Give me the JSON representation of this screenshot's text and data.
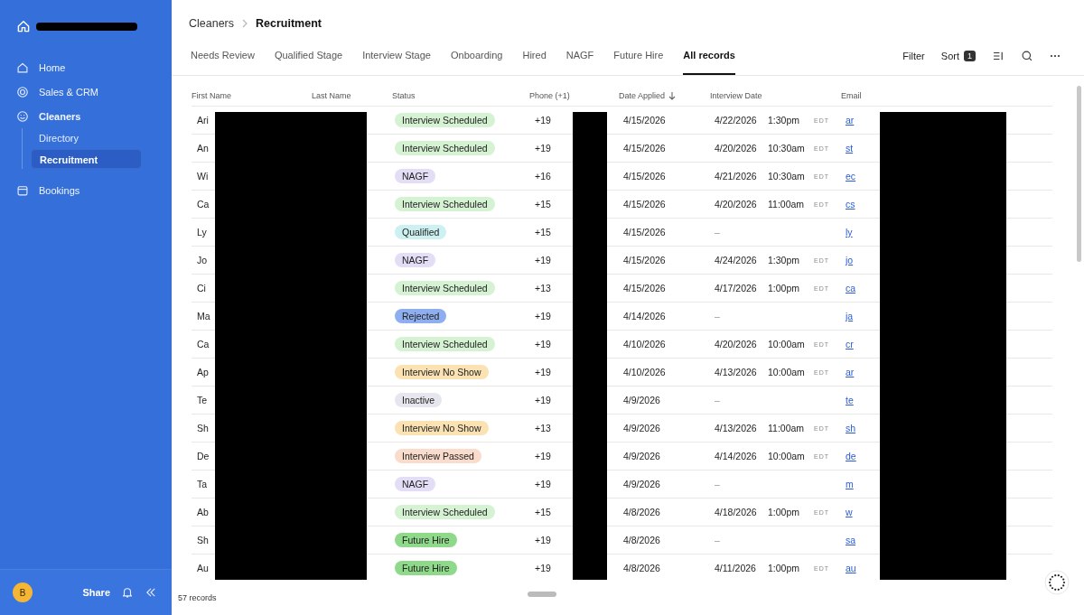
{
  "sidebar": {
    "items": [
      {
        "label": "Home",
        "bold": false,
        "selected": false
      },
      {
        "label": "Sales & CRM",
        "bold": false,
        "selected": false
      },
      {
        "label": "Cleaners",
        "bold": true,
        "selected": false,
        "children": [
          {
            "label": "Directory",
            "selected": false
          },
          {
            "label": "Recruitment",
            "selected": true
          }
        ]
      },
      {
        "label": "Bookings",
        "bold": false,
        "selected": false
      }
    ],
    "avatar": "B",
    "share": "Share"
  },
  "breadcrumb": [
    "Cleaners",
    "Recruitment"
  ],
  "tabs": [
    {
      "label": "Needs Review",
      "selected": false
    },
    {
      "label": "Qualified Stage",
      "selected": false
    },
    {
      "label": "Interview Stage",
      "selected": false
    },
    {
      "label": "Onboarding",
      "selected": false
    },
    {
      "label": "Hired",
      "selected": false
    },
    {
      "label": "NAGF",
      "selected": false
    },
    {
      "label": "Future Hire",
      "selected": false
    },
    {
      "label": "All records",
      "selected": true
    }
  ],
  "toolbar": {
    "filter": "Filter",
    "sort": "Sort",
    "sort_count": "1"
  },
  "table": {
    "columns": [
      "First Name",
      "Last Name",
      "Status",
      "Phone (+1)",
      "Date Applied",
      "Interview Date",
      "Email"
    ],
    "rows": [
      {
        "first": "Ari",
        "status": "Interview Scheduled",
        "color": "#d5f2d3",
        "phone": "+19",
        "applied": "4/15/2026",
        "interview": "4/22/2026",
        "time": "1:30pm",
        "tz": "EDT",
        "email": "ar"
      },
      {
        "first": "An",
        "status": "Interview Scheduled",
        "color": "#d5f2d3",
        "phone": "+19",
        "applied": "4/15/2026",
        "interview": "4/20/2026",
        "time": "10:30am",
        "tz": "EDT",
        "email": "st"
      },
      {
        "first": "Wi",
        "status": "NAGF",
        "color": "#e3ddf6",
        "phone": "+16",
        "applied": "4/15/2026",
        "interview": "4/21/2026",
        "time": "10:30am",
        "tz": "EDT",
        "email": "ec"
      },
      {
        "first": "Ca",
        "status": "Interview Scheduled",
        "color": "#d5f2d3",
        "phone": "+15",
        "applied": "4/15/2026",
        "interview": "4/20/2026",
        "time": "11:00am",
        "tz": "EDT",
        "email": "cs"
      },
      {
        "first": "Ly",
        "status": "Qualified",
        "color": "#cdf0f0",
        "phone": "+15",
        "applied": "4/15/2026",
        "interview": "–",
        "email": "ly"
      },
      {
        "first": "Jo",
        "status": "NAGF",
        "color": "#e3ddf6",
        "phone": "+19",
        "applied": "4/15/2026",
        "interview": "4/24/2026",
        "time": "1:30pm",
        "tz": "EDT",
        "email": "jo"
      },
      {
        "first": "Ci",
        "status": "Interview Scheduled",
        "color": "#d5f2d3",
        "phone": "+13",
        "applied": "4/15/2026",
        "interview": "4/17/2026",
        "time": "1:00pm",
        "tz": "EDT",
        "email": "ca"
      },
      {
        "first": "Ma",
        "status": "Rejected",
        "color": "#8eaef0",
        "phone": "+19",
        "applied": "4/14/2026",
        "interview": "–",
        "email": "ja"
      },
      {
        "first": "Ca",
        "status": "Interview Scheduled",
        "color": "#d5f2d3",
        "phone": "+19",
        "applied": "4/10/2026",
        "interview": "4/20/2026",
        "time": "10:00am",
        "tz": "EDT",
        "email": "cr"
      },
      {
        "first": "Ap",
        "status": "Interview No Show",
        "color": "#fbe2b3",
        "phone": "+19",
        "applied": "4/10/2026",
        "interview": "4/13/2026",
        "time": "10:00am",
        "tz": "EDT",
        "email": "ar"
      },
      {
        "first": "Te",
        "status": "Inactive",
        "color": "#e6e6ee",
        "phone": "+19",
        "applied": "4/9/2026",
        "interview": "–",
        "email": "te"
      },
      {
        "first": "Sh",
        "status": "Interview No Show",
        "color": "#fbe2b3",
        "phone": "+13",
        "applied": "4/9/2026",
        "interview": "4/13/2026",
        "time": "11:00am",
        "tz": "EDT",
        "email": "sh"
      },
      {
        "first": "De",
        "status": "Interview Passed",
        "color": "#f9dccb",
        "phone": "+19",
        "applied": "4/9/2026",
        "interview": "4/14/2026",
        "time": "10:00am",
        "tz": "EDT",
        "email": "de"
      },
      {
        "first": "Ta",
        "status": "NAGF",
        "color": "#e3ddf6",
        "phone": "+19",
        "applied": "4/9/2026",
        "interview": "–",
        "email": "m"
      },
      {
        "first": "Ab",
        "status": "Interview Scheduled",
        "color": "#d5f2d3",
        "phone": "+15",
        "applied": "4/8/2026",
        "interview": "4/18/2026",
        "time": "1:00pm",
        "tz": "EDT",
        "email": "w"
      },
      {
        "first": "Sh",
        "status": "Future Hire",
        "color": "#8fd98b",
        "phone": "+19",
        "applied": "4/8/2026",
        "interview": "–",
        "email": "sa"
      },
      {
        "first": "Au",
        "status": "Future Hire",
        "color": "#8fd98b",
        "phone": "+19",
        "applied": "4/8/2026",
        "interview": "4/11/2026",
        "time": "1:00pm",
        "tz": "EDT",
        "email": "au"
      }
    ]
  },
  "footer": {
    "count": "57 records"
  }
}
